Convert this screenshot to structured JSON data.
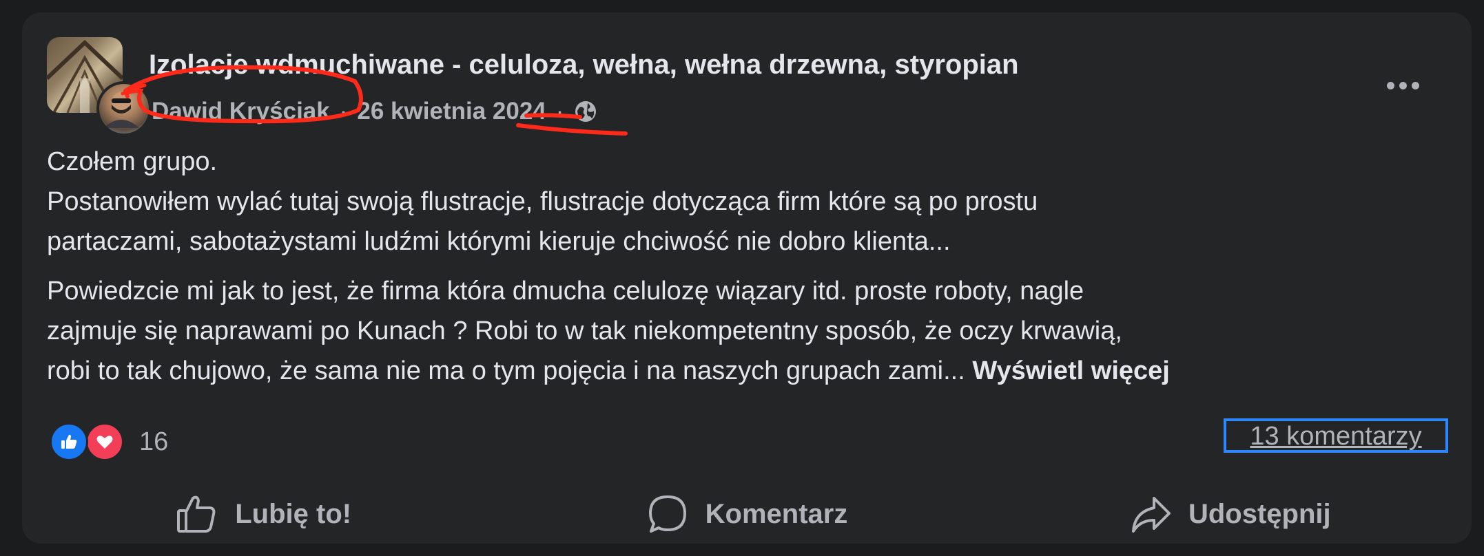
{
  "post": {
    "group_name": "Izolacje wdmuchiwane - celuloza, wełna, wełna drzewna, styropian",
    "author": "Dawid Kryściak",
    "date": "26 kwietnia 2024",
    "separator": "·",
    "privacy_icon": "globe-icon",
    "more_icon": "more-options-icon",
    "body": {
      "line1": "Czołem grupo.",
      "line2": "Postanowiłem wylać tutaj swoją flustracje, flustracje dotycząca firm które są po prostu",
      "line3": "partaczami, sabotażystami ludźmi którymi kieruje chciwość nie dobro klienta...",
      "line4": "Powiedzcie mi jak to jest, że firma która dmucha celulozę wiązary itd. proste roboty, nagle",
      "line5": "zajmuje się naprawami po Kunach ? Robi to w tak niekompetentny sposób, że oczy krwawią,",
      "line6": "robi to tak chujowo, że sama nie ma o tym pojęcia i na naszych grupach zami...",
      "see_more": "Wyświetl więcej"
    },
    "reactions": {
      "count": "16",
      "icons": [
        "like-icon",
        "love-icon"
      ]
    },
    "comments_label": "13 komentarzy"
  },
  "actions": {
    "like": "Lubię to!",
    "comment": "Komentarz",
    "share": "Udostępnij"
  },
  "colors": {
    "background": "#1b1c1d",
    "card": "#242526",
    "text_primary": "#e4e6eb",
    "text_secondary": "#b0b3b8",
    "like_blue": "#1877f2",
    "love_red": "#f33e58",
    "annotation_red": "#ff2a1a",
    "focus_outline": "#2d88ff"
  }
}
